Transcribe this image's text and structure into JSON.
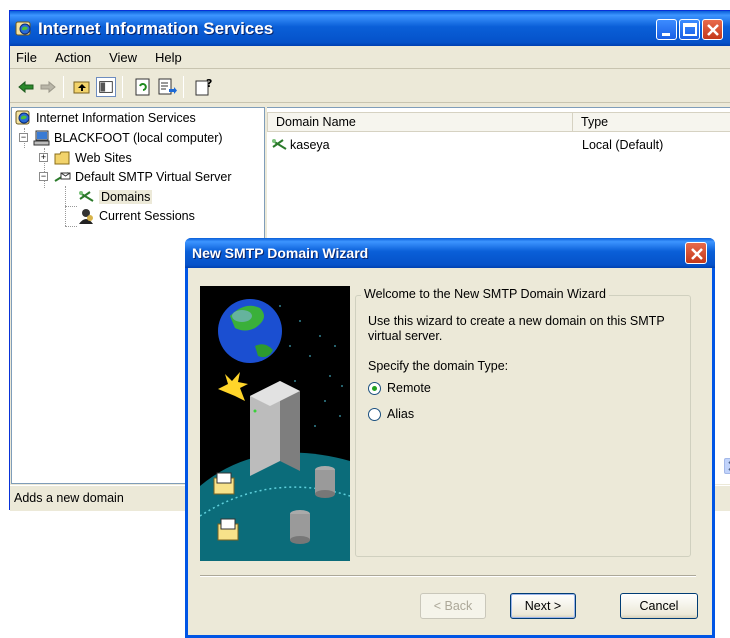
{
  "iis_window": {
    "title": "Internet Information Services",
    "menu": [
      "File",
      "Action",
      "View",
      "Help"
    ],
    "status": "Adds a new domain"
  },
  "tree": {
    "root": "Internet Information Services",
    "computer": "BLACKFOOT (local computer)",
    "web_sites": "Web Sites",
    "smtp_server": "Default SMTP Virtual Server",
    "domains": "Domains",
    "sessions": "Current Sessions"
  },
  "list": {
    "columns": [
      "Domain Name",
      "Type"
    ],
    "rows": [
      {
        "name": "kaseya",
        "type": "Local (Default)"
      }
    ]
  },
  "wizard": {
    "title": "New SMTP Domain Wizard",
    "legend": "Welcome to the New SMTP Domain Wizard",
    "description": "Use this wizard to create a new domain on this SMTP virtual server.",
    "prompt": "Specify the domain Type:",
    "options": [
      {
        "label": "Remote",
        "selected": true
      },
      {
        "label": "Alias",
        "selected": false
      }
    ],
    "buttons": {
      "back": "< Back",
      "next": "Next >",
      "cancel": "Cancel"
    }
  },
  "icons": {
    "app": "iis-icon",
    "back": "back-arrow-icon",
    "forward": "forward-arrow-icon"
  },
  "colors": {
    "titlebar": "#0a5fd8",
    "close": "#c4381a",
    "face": "#ece9d8"
  }
}
